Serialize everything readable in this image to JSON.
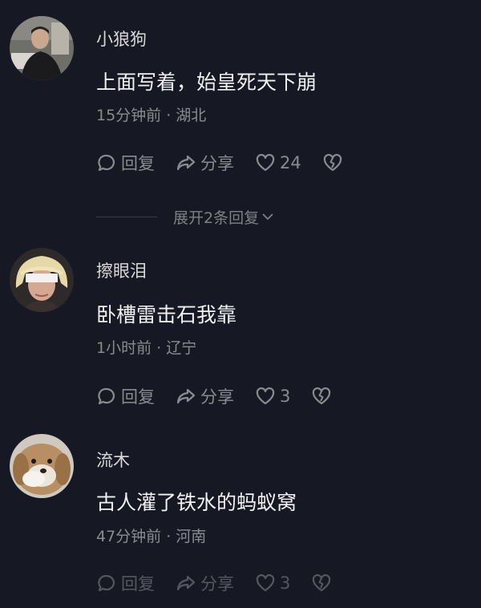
{
  "comments": [
    {
      "username": "小狼狗",
      "text": "上面写着，始皇死天下崩",
      "meta": "15分钟前 · 湖北",
      "reply_label": "回复",
      "share_label": "分享",
      "likes": "24",
      "avatar_icon": "avatar-man-dark",
      "expand_label": "展开2条回复"
    },
    {
      "username": "擦眼泪",
      "text": "卧槽雷击石我靠",
      "meta": "1小时前 · 辽宁",
      "reply_label": "回复",
      "share_label": "分享",
      "likes": "3",
      "avatar_icon": "avatar-blonde-blindfold"
    },
    {
      "username": "流木",
      "text": "古人灌了铁水的蚂蚁窝",
      "meta": "47分钟前 · 河南",
      "reply_label": "回复",
      "share_label": "分享",
      "likes": "3",
      "avatar_icon": "avatar-dog"
    }
  ],
  "colors": {
    "background": "#161823",
    "text_primary": "#f1f1f3",
    "text_secondary": "#8a8b91"
  }
}
